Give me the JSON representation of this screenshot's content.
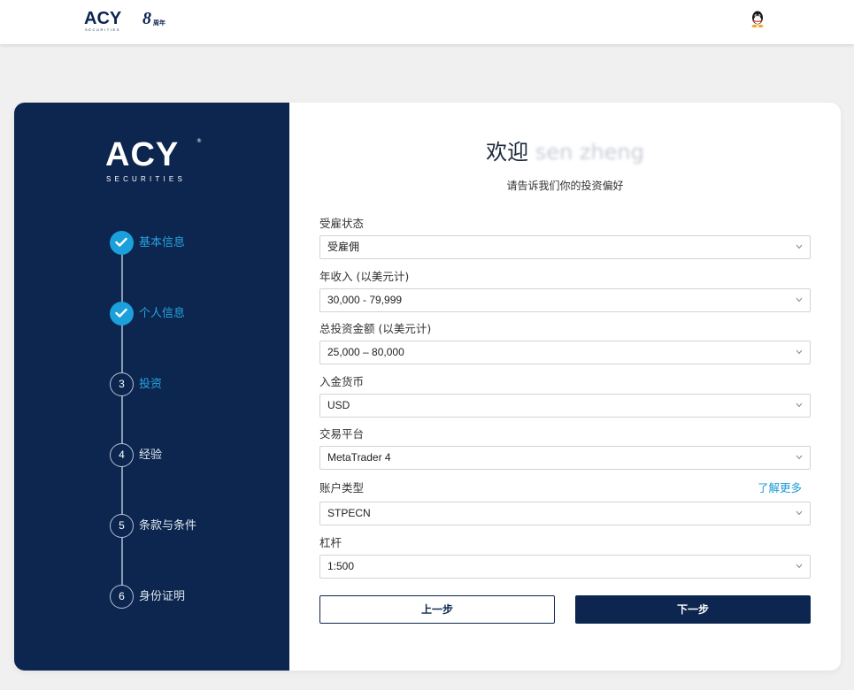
{
  "header": {
    "logo_text": "ACY",
    "logo_sub": "SECURITIES",
    "anniversary_num": "8",
    "anniversary_text": "周年",
    "qq_icon": "qq-penguin-icon"
  },
  "sidebar": {
    "logo_text": "ACY",
    "logo_sub": "SECURITIES",
    "logo_reg": "®",
    "steps": [
      {
        "num": "",
        "label": "基本信息",
        "status": "done"
      },
      {
        "num": "",
        "label": "个人信息",
        "status": "done"
      },
      {
        "num": "3",
        "label": "投资",
        "status": "current"
      },
      {
        "num": "4",
        "label": "经验",
        "status": "pending"
      },
      {
        "num": "5",
        "label": "条款与条件",
        "status": "pending"
      },
      {
        "num": "6",
        "label": "身份证明",
        "status": "pending"
      }
    ]
  },
  "form": {
    "welcome_prefix": "欢迎",
    "welcome_name": "sen zheng",
    "subtitle": "请告诉我们你的投资偏好",
    "fields": [
      {
        "label": "受雇状态",
        "value": "受雇佣"
      },
      {
        "label": "年收入 (以美元计)",
        "value": "30,000 - 79,999"
      },
      {
        "label": "总投资金额 (以美元计)",
        "value": "25,000 – 80,000"
      },
      {
        "label": "入金货币",
        "value": "USD"
      },
      {
        "label": "交易平台",
        "value": "MetaTrader 4"
      },
      {
        "label": "账户类型",
        "value": "STPECN"
      },
      {
        "label": "杠杆",
        "value": "1:500"
      }
    ],
    "learn_more": "了解更多",
    "prev_label": "上一步",
    "next_label": "下一步"
  },
  "colors": {
    "sidebar_bg": "#0c264f",
    "accent": "#1ba0dc",
    "page_bg": "#f0f0f0"
  }
}
